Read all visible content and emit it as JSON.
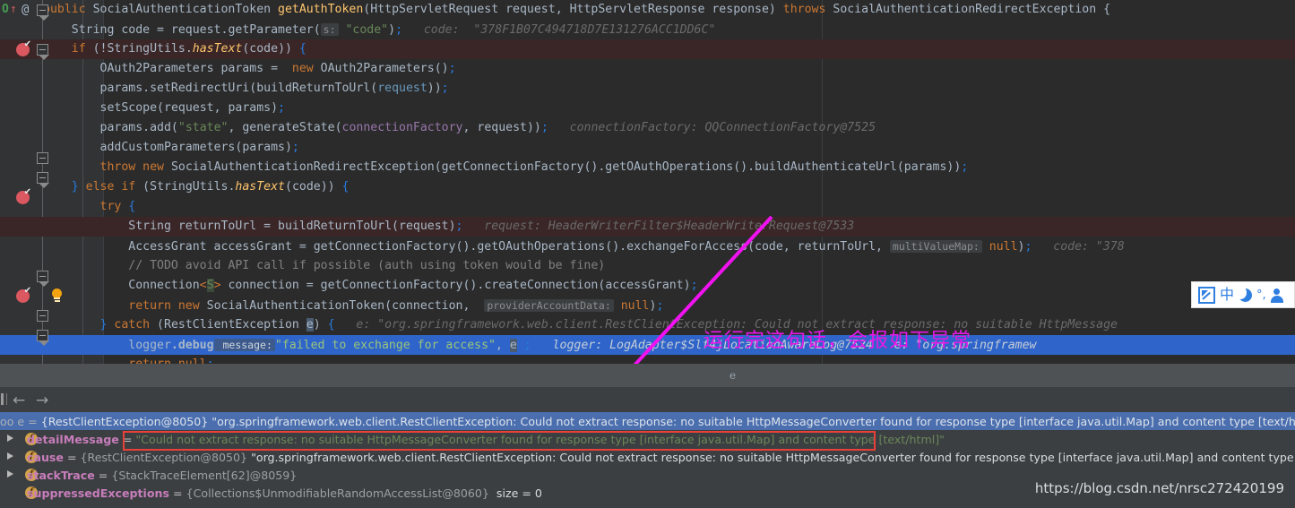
{
  "editor": {
    "gutter_marks": {
      "override_icon": "override-marker-icon",
      "arrow": "↑",
      "at_symbol": "@"
    },
    "lines": [
      {
        "id": "line-method-signature",
        "state": "normal",
        "segments": [
          {
            "cls": "kw",
            "t": "public "
          },
          {
            "cls": "typ",
            "t": "SocialAuthenticationToken "
          },
          {
            "cls": "fn",
            "t": "getAuthToken"
          },
          {
            "cls": "lpar",
            "t": "("
          },
          {
            "cls": "typ",
            "t": "HttpServletRequest request"
          },
          {
            "cls": "par",
            "t": ", "
          },
          {
            "cls": "typ",
            "t": "HttpServletResponse response"
          },
          {
            "cls": "lpar",
            "t": ")"
          },
          {
            "cls": "kw",
            "t": " throws "
          },
          {
            "cls": "typ",
            "t": "SocialAuthenticationRedirectException "
          },
          {
            "cls": "brkt",
            "t": "{"
          }
        ]
      },
      {
        "id": "line-string-code",
        "state": "normal",
        "segments": [
          {
            "cls": "id",
            "t": "    String code = request."
          },
          {
            "cls": "id",
            "t": "getParameter"
          },
          {
            "cls": "lpar",
            "t": "("
          },
          {
            "cls": "hint",
            "t": "s:"
          },
          {
            "cls": "str",
            "t": " \"code\""
          },
          {
            "cls": "lpar",
            "t": ")"
          },
          {
            "cls": "grn",
            "t": ";"
          },
          {
            "cls": "meta",
            "t": "   code:  \"378F1B07C494718D7E131276ACC1DD6C\""
          }
        ]
      },
      {
        "id": "line-if-hastext",
        "state": "error",
        "breakpoint": true,
        "segments": [
          {
            "cls": "id",
            "t": "    "
          },
          {
            "cls": "kw",
            "t": "if "
          },
          {
            "cls": "lpar",
            "t": "("
          },
          {
            "cls": "id",
            "t": "!StringUtils."
          },
          {
            "cls": "itl",
            "t": "hasText"
          },
          {
            "cls": "lpar",
            "t": "("
          },
          {
            "cls": "id",
            "t": "code"
          },
          {
            "cls": "lpar",
            "t": ")"
          },
          {
            "cls": "lpar",
            "t": ")"
          },
          {
            "cls": "grn",
            "t": " {"
          }
        ]
      },
      {
        "id": "line-oauth2params-new",
        "state": "normal",
        "segments": [
          {
            "cls": "id",
            "t": "        OAuth2Parameters params =  "
          },
          {
            "cls": "kw",
            "t": "new "
          },
          {
            "cls": "id",
            "t": "OAuth2Parameters"
          },
          {
            "cls": "lpar",
            "t": "()"
          },
          {
            "cls": "grn",
            "t": ";"
          }
        ]
      },
      {
        "id": "line-set-redirect-uri",
        "state": "normal",
        "segments": [
          {
            "cls": "id",
            "t": "        params.setRedirectUri"
          },
          {
            "cls": "lpar",
            "t": "("
          },
          {
            "cls": "id",
            "t": "buildReturnToUrl"
          },
          {
            "cls": "lpar",
            "t": "("
          },
          {
            "cls": "blue",
            "t": "request"
          },
          {
            "cls": "lpar",
            "t": "))"
          },
          {
            "cls": "grn",
            "t": ";"
          }
        ]
      },
      {
        "id": "line-set-scope",
        "state": "normal",
        "segments": [
          {
            "cls": "id",
            "t": "        setScope"
          },
          {
            "cls": "lpar",
            "t": "("
          },
          {
            "cls": "id",
            "t": "request, params"
          },
          {
            "cls": "lpar",
            "t": ")"
          },
          {
            "cls": "grn",
            "t": ";"
          }
        ]
      },
      {
        "id": "line-params-add-state",
        "state": "normal",
        "segments": [
          {
            "cls": "id",
            "t": "        params.add"
          },
          {
            "cls": "lpar",
            "t": "("
          },
          {
            "cls": "str",
            "t": "\"state\""
          },
          {
            "cls": "par",
            "t": ", "
          },
          {
            "cls": "id",
            "t": "generateState"
          },
          {
            "cls": "lpar",
            "t": "("
          },
          {
            "cls": "fld",
            "t": "connectionFactory"
          },
          {
            "cls": "par",
            "t": ", "
          },
          {
            "cls": "id",
            "t": "request"
          },
          {
            "cls": "lpar",
            "t": "))"
          },
          {
            "cls": "grn",
            "t": ";"
          },
          {
            "cls": "meta",
            "t": "   connectionFactory: QQConnectionFactory@7525"
          }
        ]
      },
      {
        "id": "line-add-custom-parameters",
        "state": "normal",
        "segments": [
          {
            "cls": "id",
            "t": "        addCustomParameters"
          },
          {
            "cls": "lpar",
            "t": "("
          },
          {
            "cls": "id",
            "t": "params"
          },
          {
            "cls": "lpar",
            "t": ")"
          },
          {
            "cls": "grn",
            "t": ";"
          }
        ]
      },
      {
        "id": "line-throw-redirect",
        "state": "normal",
        "segments": [
          {
            "cls": "id",
            "t": "        "
          },
          {
            "cls": "kw",
            "t": "throw new "
          },
          {
            "cls": "id",
            "t": "SocialAuthenticationRedirectException"
          },
          {
            "cls": "lpar",
            "t": "("
          },
          {
            "cls": "id",
            "t": "getConnectionFactory"
          },
          {
            "cls": "lpar",
            "t": "()"
          },
          {
            "cls": "id",
            "t": ".getOAuthOperations"
          },
          {
            "cls": "lpar",
            "t": "()"
          },
          {
            "cls": "id",
            "t": ".buildAuthenticateUrl"
          },
          {
            "cls": "lpar",
            "t": "("
          },
          {
            "cls": "id",
            "t": "params"
          },
          {
            "cls": "lpar",
            "t": "))"
          },
          {
            "cls": "grn",
            "t": ";"
          }
        ]
      },
      {
        "id": "line-else-if-hastext",
        "state": "normal",
        "segments": [
          {
            "cls": "grn",
            "t": "    }"
          },
          {
            "cls": "kw",
            "t": " else if "
          },
          {
            "cls": "lpar",
            "t": "("
          },
          {
            "cls": "id",
            "t": "StringUtils."
          },
          {
            "cls": "itl",
            "t": "hasText"
          },
          {
            "cls": "lpar",
            "t": "("
          },
          {
            "cls": "id",
            "t": "code"
          },
          {
            "cls": "lpar",
            "t": "))"
          },
          {
            "cls": "grn",
            "t": " {"
          }
        ]
      },
      {
        "id": "line-try",
        "state": "normal",
        "segments": [
          {
            "cls": "kw",
            "t": "        try "
          },
          {
            "cls": "grn",
            "t": "{"
          }
        ]
      },
      {
        "id": "line-return-to-url",
        "state": "error",
        "breakpoint": true,
        "segments": [
          {
            "cls": "id",
            "t": "            String returnToUrl = buildReturnToUrl"
          },
          {
            "cls": "lpar",
            "t": "("
          },
          {
            "cls": "id",
            "t": "request"
          },
          {
            "cls": "lpar",
            "t": ")"
          },
          {
            "cls": "grn",
            "t": ";"
          },
          {
            "cls": "meta",
            "t": "   request: HeaderWriterFilter$HeaderWriterRequest@7533"
          }
        ]
      },
      {
        "id": "line-exchange-for-access",
        "state": "normal",
        "segments": [
          {
            "cls": "id",
            "t": "            AccessGrant accessGrant = getConnectionFactory"
          },
          {
            "cls": "lpar",
            "t": "()"
          },
          {
            "cls": "id",
            "t": ".getOAuthOperations"
          },
          {
            "cls": "lpar",
            "t": "()"
          },
          {
            "cls": "id",
            "t": ".exchangeForAccess"
          },
          {
            "cls": "lpar",
            "t": "("
          },
          {
            "cls": "id",
            "t": "code"
          },
          {
            "cls": "par",
            "t": ", "
          },
          {
            "cls": "id",
            "t": "returnToUrl"
          },
          {
            "cls": "par",
            "t": ", "
          },
          {
            "cls": "hint",
            "t": "multiValueMap:"
          },
          {
            "cls": "kw",
            "t": " null"
          },
          {
            "cls": "lpar",
            "t": ")"
          },
          {
            "cls": "grn",
            "t": ";"
          },
          {
            "cls": "meta",
            "t": "   code: \"378"
          }
        ]
      },
      {
        "id": "line-todo-comment",
        "state": "normal",
        "segments": [
          {
            "cls": "cmt",
            "t": "            // TODO avoid API call if possible (auth using token would be fine)"
          }
        ]
      },
      {
        "id": "line-create-connection",
        "state": "normal",
        "segments": [
          {
            "cls": "id",
            "t": "            Connection"
          },
          {
            "cls": "kw",
            "t": "<"
          },
          {
            "cls": "grn2",
            "t": "S"
          },
          {
            "cls": "kw",
            "t": ">"
          },
          {
            "cls": "id",
            "t": " connection = getConnectionFactory"
          },
          {
            "cls": "lpar",
            "t": "()"
          },
          {
            "cls": "id",
            "t": ".createConnection"
          },
          {
            "cls": "lpar",
            "t": "("
          },
          {
            "cls": "id",
            "t": "accessGrant"
          },
          {
            "cls": "lpar",
            "t": ")"
          },
          {
            "cls": "grn",
            "t": ";"
          }
        ]
      },
      {
        "id": "line-return-new-token",
        "state": "normal",
        "segments": [
          {
            "cls": "id",
            "t": "            "
          },
          {
            "cls": "kw",
            "t": "return new "
          },
          {
            "cls": "id",
            "t": "SocialAuthenticationToken"
          },
          {
            "cls": "lpar",
            "t": "("
          },
          {
            "cls": "id",
            "t": "connection"
          },
          {
            "cls": "par",
            "t": ",  "
          },
          {
            "cls": "hint",
            "t": "providerAccountData:"
          },
          {
            "cls": "kw",
            "t": " null"
          },
          {
            "cls": "lpar",
            "t": ")"
          },
          {
            "cls": "grn",
            "t": ";"
          }
        ]
      },
      {
        "id": "line-catch-restclient",
        "state": "normal",
        "segments": [
          {
            "cls": "grn",
            "t": "        }"
          },
          {
            "cls": "kw",
            "t": " catch "
          },
          {
            "cls": "lpar",
            "t": "("
          },
          {
            "cls": "id",
            "t": "RestClientException "
          },
          {
            "cls": "idsel",
            "t": "e"
          },
          {
            "cls": "lpar",
            "t": ")"
          },
          {
            "cls": "grn",
            "t": " {"
          },
          {
            "cls": "meta",
            "t": "   e: \"org.springframework.web.client.RestClientException: Could not extract response: no suitable HttpMessage"
          }
        ]
      },
      {
        "id": "line-logger-debug",
        "state": "selected",
        "breakpoint": true,
        "bulb": true,
        "segments": [
          {
            "cls": "id",
            "t": "            logger"
          },
          {
            "cls": "idb",
            "t": ".debug"
          },
          {
            "cls": "hint",
            "t": " message:"
          },
          {
            "cls": "strsel",
            "t": "\"failed to exchange for access\""
          },
          {
            "cls": "par",
            "t": ", "
          },
          {
            "cls": "idsel",
            "t": "e"
          },
          {
            "cls": "grn",
            "t": " ;"
          },
          {
            "cls": "metasel",
            "t": "   logger: LogAdapter$Slf4jLocationAwareLog@7524   e: \"org.springframew"
          }
        ]
      },
      {
        "id": "line-return-null-1",
        "state": "normal",
        "segments": [
          {
            "cls": "kw",
            "t": "            return null"
          },
          {
            "cls": "grn",
            "t": ";"
          }
        ]
      },
      {
        "id": "line-close-brace-try",
        "state": "normal",
        "segments": [
          {
            "cls": "grn",
            "t": "        }"
          }
        ]
      },
      {
        "id": "line-else",
        "state": "normal",
        "segments": [
          {
            "cls": "grn",
            "t": "    }"
          },
          {
            "cls": "kw",
            "t": " else "
          },
          {
            "cls": "grn",
            "t": "{"
          }
        ]
      },
      {
        "id": "line-return-null-2",
        "state": "normal",
        "segments": [
          {
            "cls": "kw",
            "t": "        return null"
          },
          {
            "cls": "grn",
            "t": ";"
          }
        ]
      }
    ],
    "annotation": {
      "text": "运行完这句话，会报如下异常",
      "color": "#e817e8",
      "arrow_name": "magenta-callout-arrow"
    }
  },
  "ime_toolbar": {
    "items": [
      {
        "name": "handwriting-pen-icon",
        "glyph": ""
      },
      {
        "name": "chinese-mode-icon",
        "glyph": "中"
      },
      {
        "name": "moon-icon",
        "glyph": ""
      },
      {
        "name": "punctuation-icon",
        "glyph": "°,"
      },
      {
        "name": "user-icon",
        "glyph": ""
      }
    ]
  },
  "splitter": {
    "center_glyph": "e"
  },
  "debug_panel": {
    "toolbar": {
      "stack_icon": "call-stack-icon",
      "back_arrow": "←",
      "forward_arrow": "→"
    },
    "rows": [
      {
        "name": "variable-row-exception",
        "selected": true,
        "twisty": false,
        "ficon": false,
        "indented": false,
        "prefix": "oo e = ",
        "ref": "{RestClientException@8050}",
        "value": " \"org.springframework.web.client.RestClientException: Could not extract response: no suitable HttpMessageConverter found for response type [interface java.util.Map] and content type [text/html]\""
      },
      {
        "name": "variable-row-detailMessage",
        "selected": false,
        "twisty": true,
        "ficon": true,
        "indented": true,
        "field": "detailMessage",
        "eq": " = ",
        "string_value": "\"Could not extract response: no suitable HttpMessageConverter found for response type [interface java.util.Map] and content type [text/html]\""
      },
      {
        "name": "variable-row-cause",
        "selected": false,
        "twisty": true,
        "ficon": true,
        "indented": true,
        "field": "cause",
        "eq": " = ",
        "ref": "{RestClientException@8050}",
        "value": " \"org.springframework.web.client.RestClientException: Could not extract response: no suitable HttpMessageConverter found for response type [interface java.util.Map] and content type [text/html]\""
      },
      {
        "name": "variable-row-stackTrace",
        "selected": false,
        "twisty": true,
        "ficon": true,
        "indented": true,
        "field": "stackTrace",
        "eq": " = ",
        "ref": "{StackTraceElement[62]@8059}"
      },
      {
        "name": "variable-row-suppressedExceptions",
        "selected": false,
        "twisty": false,
        "ficon": true,
        "indented": true,
        "field": "suppressedExceptions",
        "eq": " = ",
        "ref": "{Collections$UnmodifiableRandomAccessList@8060}",
        "value": "  size = 0"
      }
    ],
    "highlight_box_name": "red-highlight-box"
  },
  "watermark": {
    "text": "https://blog.csdn.net/nrsc272420199"
  }
}
